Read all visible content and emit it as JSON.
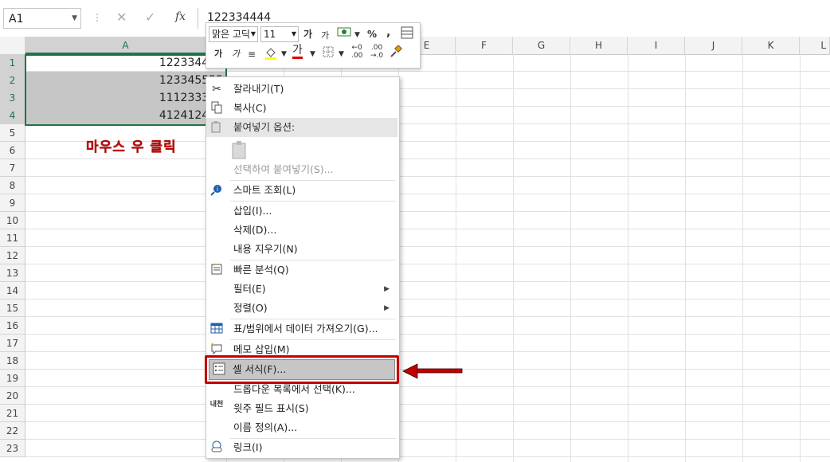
{
  "name_box": {
    "value": "A1"
  },
  "formula_bar": {
    "cancel_icon": "✕",
    "enter_icon": "✓",
    "fx_label": "fx",
    "value": "122334444"
  },
  "columns": [
    "A",
    "B",
    "C",
    "D",
    "E",
    "F",
    "G",
    "H",
    "I",
    "J",
    "K",
    "L"
  ],
  "rows": [
    "1",
    "2",
    "3",
    "4",
    "5",
    "6",
    "7",
    "8",
    "9",
    "10",
    "11",
    "12",
    "13",
    "14",
    "15",
    "16",
    "17",
    "18",
    "19",
    "20",
    "21",
    "22",
    "23"
  ],
  "cells": [
    {
      "ref": "A1",
      "value": "122334444"
    },
    {
      "ref": "A2",
      "value": "123345555"
    },
    {
      "ref": "A3",
      "value": "111233333"
    },
    {
      "ref": "A4",
      "value": "412412421"
    }
  ],
  "annotation": "마우스 우 클릭",
  "mini_toolbar": {
    "font_name": "맑은 고딕",
    "font_size": "11",
    "grow_font": "가",
    "shrink_font": "가",
    "percent": "%",
    "comma": ",",
    "bold": "가",
    "italic": "가",
    "font_color_letter": "가",
    "inc_decimal_top": "←0",
    "inc_decimal_bottom": ".00",
    "dec_decimal_top": ".00",
    "dec_decimal_bottom": "→.0"
  },
  "context_menu": {
    "items": [
      {
        "label": "잘라내기(T)",
        "icon": "cut-icon"
      },
      {
        "label": "복사(C)",
        "icon": "copy-icon"
      },
      {
        "label": "붙여넣기 옵션:",
        "icon": "paste-icon"
      },
      {
        "label": "선택하여 붙여넣기(S)...",
        "disabled": true
      },
      {
        "label": "스마트 조회(L)",
        "icon": "smart-lookup-icon"
      },
      {
        "label": "삽입(I)..."
      },
      {
        "label": "삭제(D)..."
      },
      {
        "label": "내용 지우기(N)"
      },
      {
        "label": "빠른 분석(Q)",
        "icon": "quick-analysis-icon"
      },
      {
        "label": "필터(E)",
        "submenu": true
      },
      {
        "label": "정렬(O)",
        "submenu": true
      },
      {
        "label": "표/범위에서 데이터 가져오기(G)...",
        "icon": "table-icon"
      },
      {
        "label": "메모 삽입(M)",
        "icon": "comment-icon"
      },
      {
        "label": "셀 서식(F)...",
        "icon": "format-cells-icon",
        "highlighted": true
      },
      {
        "label": "드롭다운 목록에서 선택(K)..."
      },
      {
        "label": "윗주 필드 표시(S)",
        "icon": "phonetic-icon"
      },
      {
        "label": "이름 정의(A)..."
      },
      {
        "label": "링크(I)",
        "icon": "link-icon"
      }
    ],
    "submenu_arrow": "▶",
    "phonetic_glyph": "내천"
  },
  "colors": {
    "accent": "#217346",
    "highlight_border": "#c00000",
    "annotation": "#c00000"
  }
}
